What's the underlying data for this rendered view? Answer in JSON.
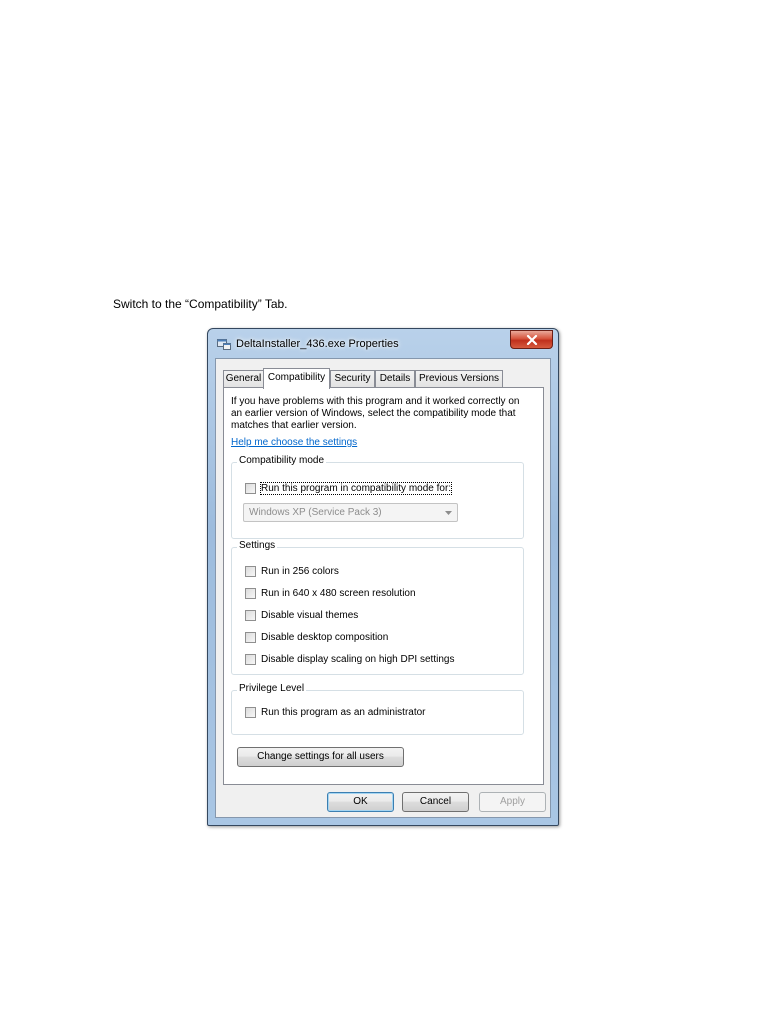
{
  "instruction": "Switch to the “Compatibility” Tab.",
  "window": {
    "title": "DeltaInstaller_436.exe Properties",
    "close_label": "x"
  },
  "tabs": [
    {
      "label": "General"
    },
    {
      "label": "Compatibility"
    },
    {
      "label": "Security"
    },
    {
      "label": "Details"
    },
    {
      "label": "Previous Versions"
    }
  ],
  "compat": {
    "intro": "If you have problems with this program and it worked correctly on an earlier version of Windows, select the compatibility mode that matches that earlier version.",
    "help_link": "Help me choose the settings",
    "mode_group": {
      "title": "Compatibility mode",
      "checkbox_label": "Run this program in compatibility mode for:",
      "checked": false,
      "select_value": "Windows XP (Service Pack 3)"
    },
    "settings_group": {
      "title": "Settings",
      "items": [
        {
          "label": "Run in 256 colors",
          "checked": false
        },
        {
          "label": "Run in 640 x 480 screen resolution",
          "checked": false
        },
        {
          "label": "Disable visual themes",
          "checked": false
        },
        {
          "label": "Disable desktop composition",
          "checked": false
        },
        {
          "label": "Disable display scaling on high DPI settings",
          "checked": false
        }
      ]
    },
    "privilege_group": {
      "title": "Privilege Level",
      "checkbox_label": "Run this program as an administrator",
      "checked": false
    },
    "change_all_button": "Change settings for all users"
  },
  "footer": {
    "ok": "OK",
    "cancel": "Cancel",
    "apply": "Apply"
  }
}
